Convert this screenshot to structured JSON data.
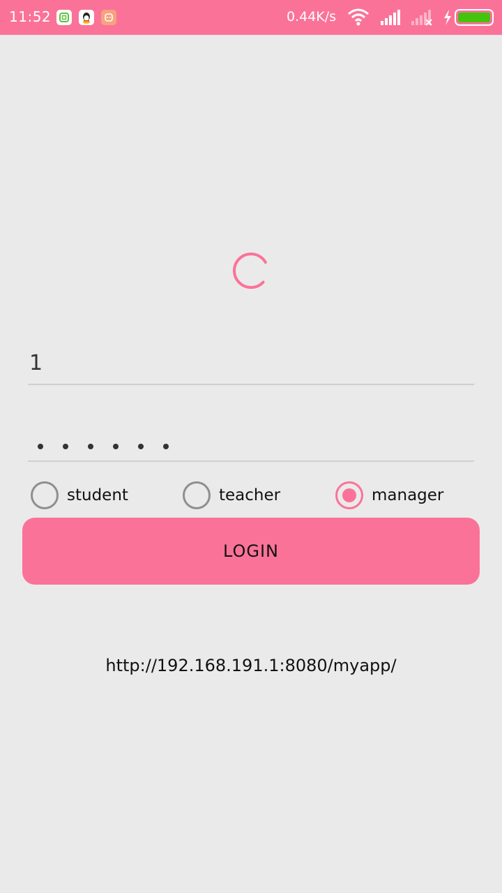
{
  "status_bar": {
    "time": "11:52",
    "net_speed": "0.44K/s",
    "notification_icons": [
      "wechat-icon",
      "qq-icon",
      "app-icon"
    ],
    "indicators": [
      "wifi-icon",
      "signal-icon",
      "signal-no-sim-icon",
      "charging-icon",
      "battery-icon"
    ],
    "battery_level": 1.0,
    "colors": {
      "bar": "#fb7299",
      "battery_fill": "#44c40c"
    }
  },
  "loading": {
    "spinner_color": "#fb7299"
  },
  "login_form": {
    "username": {
      "value": "1"
    },
    "password": {
      "masked_length": 6
    },
    "roles": [
      {
        "label": "student",
        "checked": false
      },
      {
        "label": "teacher",
        "checked": false
      },
      {
        "label": "manager",
        "checked": true
      }
    ],
    "login_label": "LOGIN",
    "server_url": "http://192.168.191.1:8080/myapp/"
  },
  "colors": {
    "accent": "#fb7299",
    "background": "#eaeaea",
    "radio_off": "#8e8e8e"
  }
}
